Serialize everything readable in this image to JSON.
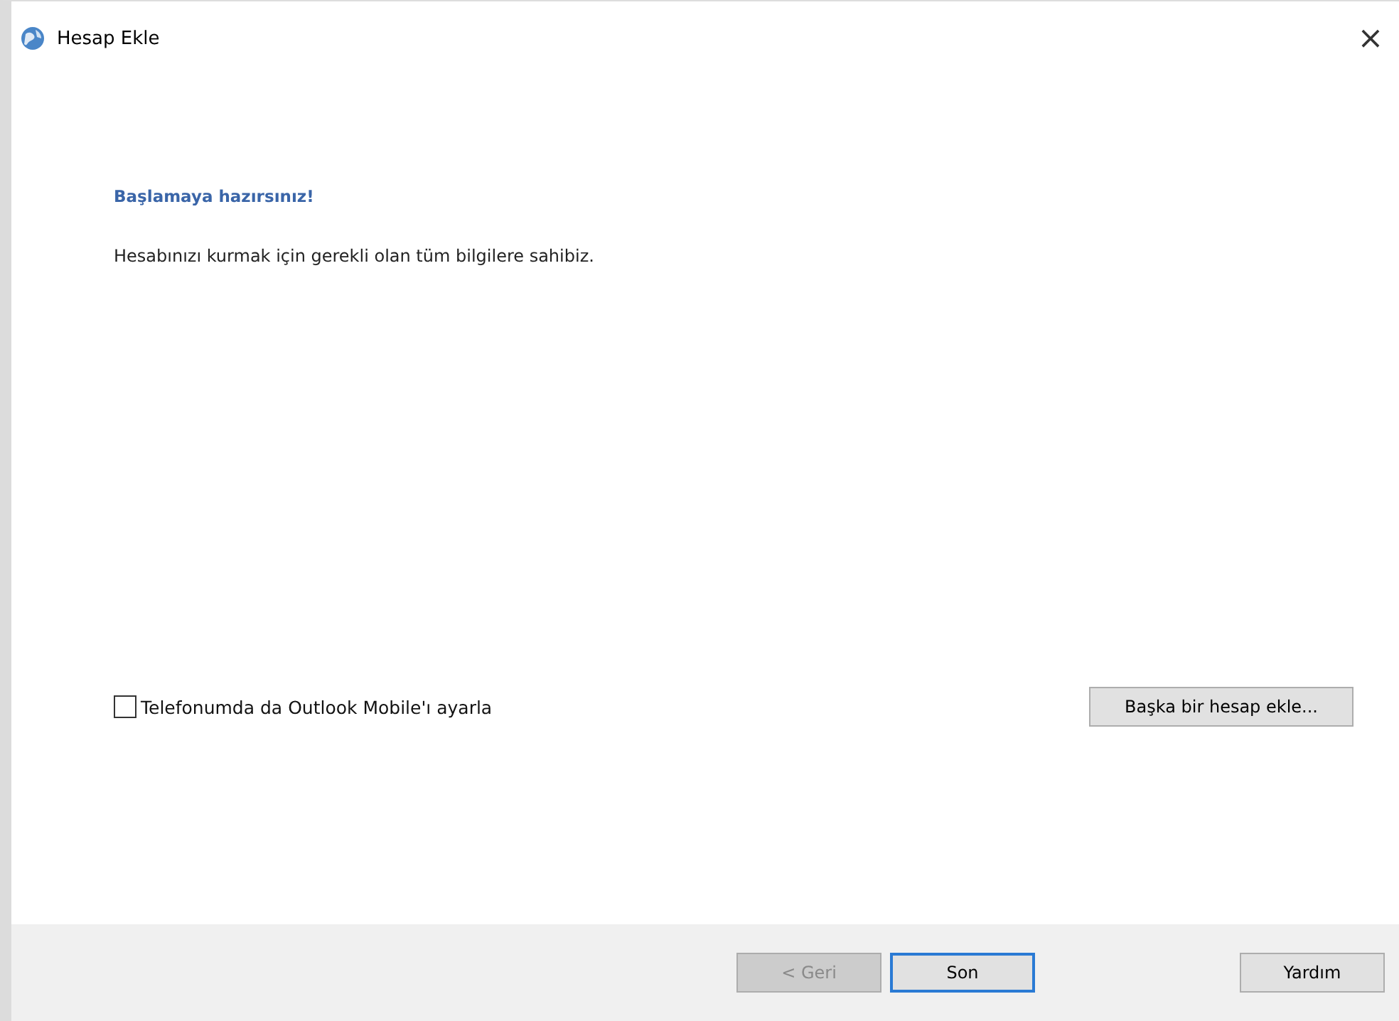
{
  "window": {
    "title": "Hesap Ekle",
    "close": "×"
  },
  "heading": "Başlamaya hazırsınız!",
  "message": "Hesabınızı kurmak için gerekli olan tüm bilgilere sahibiz.",
  "mobile_checkbox": {
    "label": "Telefonumda da Outlook Mobile'ı ayarla",
    "checked": false
  },
  "add_another_button": "Başka bir hesap ekle...",
  "footer_buttons": [
    {
      "label": "< Geri",
      "disabled": true,
      "default": false
    },
    {
      "label": "Son",
      "disabled": false,
      "default": true
    },
    {
      "label": "Yardım",
      "disabled": false,
      "default": false
    }
  ]
}
